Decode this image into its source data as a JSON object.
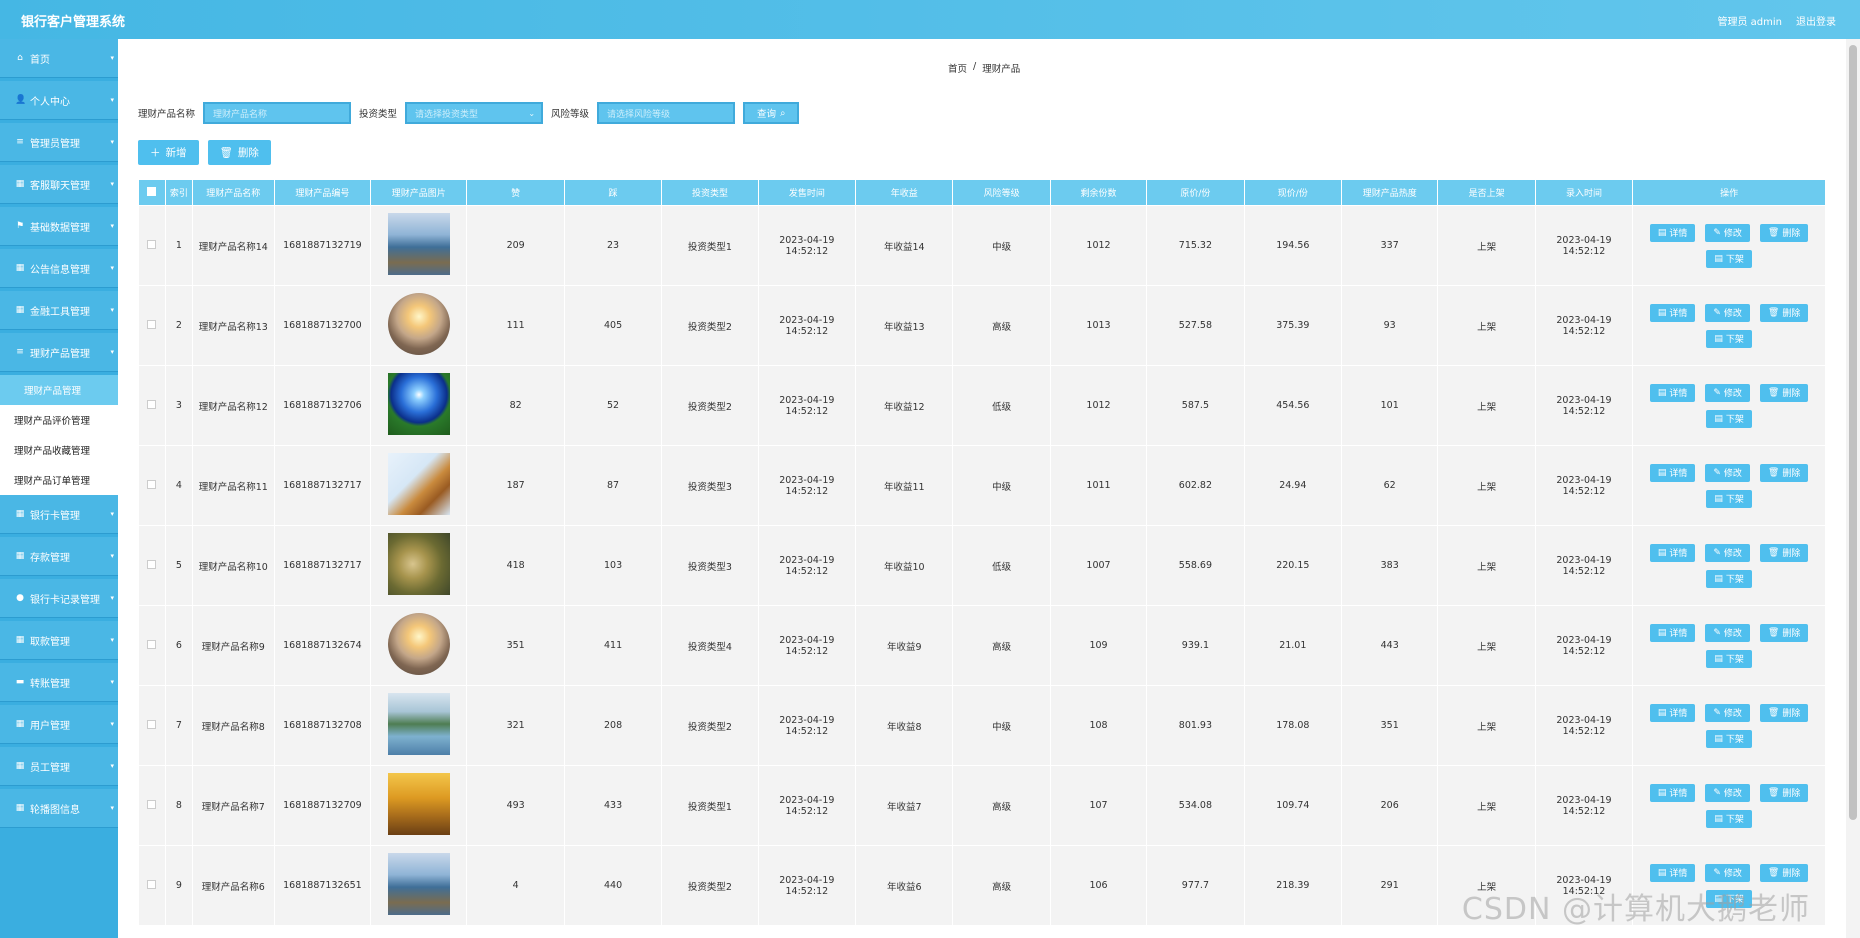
{
  "app": {
    "title": "银行客户管理系统",
    "user": "管理员 admin",
    "logout": "退出登录"
  },
  "sidebar": {
    "items": [
      {
        "icon": "home-icon",
        "glyph": "⌂",
        "label": "首页"
      },
      {
        "icon": "user-icon",
        "glyph": "👤",
        "label": "个人中心"
      },
      {
        "icon": "list-icon",
        "glyph": "≡",
        "label": "管理员管理"
      },
      {
        "icon": "grid-icon",
        "glyph": "▦",
        "label": "客服聊天管理"
      },
      {
        "icon": "flag-icon",
        "glyph": "⚑",
        "label": "基础数据管理"
      },
      {
        "icon": "grid-icon",
        "glyph": "▦",
        "label": "公告信息管理"
      },
      {
        "icon": "grid-icon",
        "glyph": "▦",
        "label": "金融工具管理"
      },
      {
        "icon": "list-icon",
        "glyph": "≡",
        "label": "理财产品管理"
      }
    ],
    "sub_items": [
      "理财产品管理",
      "理财产品评价管理",
      "理财产品收藏管理",
      "理财产品订单管理"
    ],
    "items_after": [
      {
        "icon": "grid-icon",
        "glyph": "▦",
        "label": "银行卡管理"
      },
      {
        "icon": "grid-icon",
        "glyph": "▦",
        "label": "存款管理"
      },
      {
        "icon": "pin-icon",
        "glyph": "●",
        "label": "银行卡记录管理"
      },
      {
        "icon": "grid-icon",
        "glyph": "▦",
        "label": "取款管理"
      },
      {
        "icon": "card-icon",
        "glyph": "▬",
        "label": "转账管理"
      },
      {
        "icon": "grid-icon",
        "glyph": "▦",
        "label": "用户管理"
      },
      {
        "icon": "grid-icon",
        "glyph": "▦",
        "label": "员工管理"
      },
      {
        "icon": "grid-icon",
        "glyph": "▦",
        "label": "轮播图信息"
      }
    ]
  },
  "breadcrumb": {
    "home": "首页",
    "sep": "/",
    "current": "理财产品"
  },
  "search": {
    "name_label": "理财产品名称",
    "name_placeholder": "理财产品名称",
    "type_label": "投资类型",
    "type_placeholder": "请选择投资类型",
    "risk_label": "风险等级",
    "risk_placeholder": "请选择风险等级",
    "query": "查询"
  },
  "toolbar": {
    "add": "新增",
    "delete": "删除"
  },
  "table": {
    "headers": [
      "索引",
      "理财产品名称",
      "理财产品编号",
      "理财产品图片",
      "赞",
      "踩",
      "投资类型",
      "发售时间",
      "年收益",
      "风险等级",
      "剩余份数",
      "原价/份",
      "现价/份",
      "理财产品热度",
      "是否上架",
      "录入时间",
      "操作"
    ],
    "rows": [
      {
        "idx": "1",
        "name": "理财产品名称14",
        "code": "1681887132719",
        "img": "img-lake",
        "like": "209",
        "dislike": "23",
        "type": "投资类型1",
        "sale_time": "2023-04-19 14:52:12",
        "yield": "年收益14",
        "risk": "中级",
        "remain": "1012",
        "orig": "715.32",
        "now": "194.56",
        "heat": "337",
        "shelf": "上架",
        "entry": "2023-04-19 14:52:12"
      },
      {
        "idx": "2",
        "name": "理财产品名称13",
        "code": "1681887132700",
        "img": "img-circle",
        "like": "111",
        "dislike": "405",
        "type": "投资类型2",
        "sale_time": "2023-04-19 14:52:12",
        "yield": "年收益13",
        "risk": "高级",
        "remain": "1013",
        "orig": "527.58",
        "now": "375.39",
        "heat": "93",
        "shelf": "上架",
        "entry": "2023-04-19 14:52:12"
      },
      {
        "idx": "3",
        "name": "理财产品名称12",
        "code": "1681887132706",
        "img": "img-blue",
        "like": "82",
        "dislike": "52",
        "type": "投资类型2",
        "sale_time": "2023-04-19 14:52:12",
        "yield": "年收益12",
        "risk": "低级",
        "remain": "1012",
        "orig": "587.5",
        "now": "454.56",
        "heat": "101",
        "shelf": "上架",
        "entry": "2023-04-19 14:52:12"
      },
      {
        "idx": "4",
        "name": "理财产品名称11",
        "code": "1681887132717",
        "img": "img-leaf",
        "like": "187",
        "dislike": "87",
        "type": "投资类型3",
        "sale_time": "2023-04-19 14:52:12",
        "yield": "年收益11",
        "risk": "中级",
        "remain": "1011",
        "orig": "602.82",
        "now": "24.94",
        "heat": "62",
        "shelf": "上架",
        "entry": "2023-04-19 14:52:12"
      },
      {
        "idx": "5",
        "name": "理财产品名称10",
        "code": "1681887132717",
        "img": "img-forest",
        "like": "418",
        "dislike": "103",
        "type": "投资类型3",
        "sale_time": "2023-04-19 14:52:12",
        "yield": "年收益10",
        "risk": "低级",
        "remain": "1007",
        "orig": "558.69",
        "now": "220.15",
        "heat": "383",
        "shelf": "上架",
        "entry": "2023-04-19 14:52:12"
      },
      {
        "idx": "6",
        "name": "理财产品名称9",
        "code": "1681887132674",
        "img": "img-circle",
        "like": "351",
        "dislike": "411",
        "type": "投资类型4",
        "sale_time": "2023-04-19 14:52:12",
        "yield": "年收益9",
        "risk": "高级",
        "remain": "109",
        "orig": "939.1",
        "now": "21.01",
        "heat": "443",
        "shelf": "上架",
        "entry": "2023-04-19 14:52:12"
      },
      {
        "idx": "7",
        "name": "理财产品名称8",
        "code": "1681887132708",
        "img": "img-mountain",
        "like": "321",
        "dislike": "208",
        "type": "投资类型2",
        "sale_time": "2023-04-19 14:52:12",
        "yield": "年收益8",
        "risk": "中级",
        "remain": "108",
        "orig": "801.93",
        "now": "178.08",
        "heat": "351",
        "shelf": "上架",
        "entry": "2023-04-19 14:52:12"
      },
      {
        "idx": "8",
        "name": "理财产品名称7",
        "code": "1681887132709",
        "img": "img-autumn",
        "like": "493",
        "dislike": "433",
        "type": "投资类型1",
        "sale_time": "2023-04-19 14:52:12",
        "yield": "年收益7",
        "risk": "高级",
        "remain": "107",
        "orig": "534.08",
        "now": "109.74",
        "heat": "206",
        "shelf": "上架",
        "entry": "2023-04-19 14:52:12"
      },
      {
        "idx": "9",
        "name": "理财产品名称6",
        "code": "1681887132651",
        "img": "img-lake",
        "like": "4",
        "dislike": "440",
        "type": "投资类型2",
        "sale_time": "2023-04-19 14:52:12",
        "yield": "年收益6",
        "risk": "高级",
        "remain": "106",
        "orig": "977.7",
        "now": "218.39",
        "heat": "291",
        "shelf": "上架",
        "entry": "2023-04-19 14:52:12"
      }
    ],
    "ops": {
      "detail": "详情",
      "edit": "修改",
      "delete": "删除",
      "offshelf": "下架"
    }
  },
  "watermark": "CSDN @计算机大鹅老师"
}
